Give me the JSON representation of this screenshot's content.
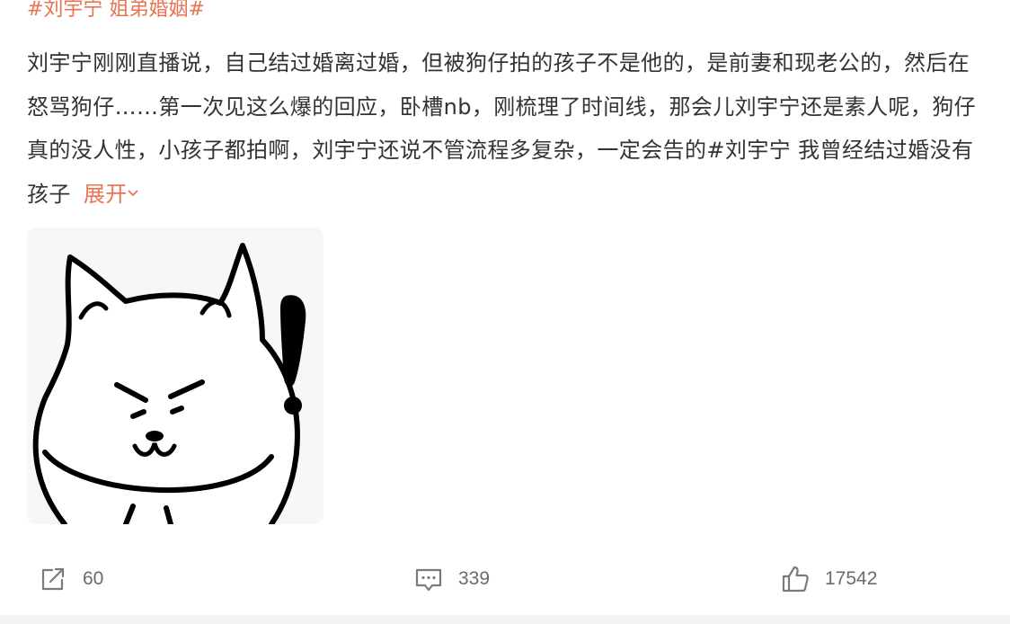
{
  "post": {
    "topics_top": [
      "#刘宇宁",
      "姐弟婚姻#"
    ],
    "body_text": "刘宇宁刚刚直播说，自己结过婚离过婚，但被狗仔拍的孩子不是他的，是前妻和现老公的，然后在怒骂狗仔……第一次见这么爆的回应，卧槽nb，刚梳理了时间线，那会儿刘宇宁还是素人呢，狗仔真的没人性，小孩子都拍啊，刘宇宁还说不管流程多复杂，一定会告的",
    "inline_topic": "#刘宇宁 我曾经结过婚没有孩子",
    "expand_label": "展开",
    "image": {
      "alt_icon": "cat-exclamation-sticker"
    }
  },
  "footer": {
    "repost": {
      "icon": "share-icon",
      "count": "60"
    },
    "comment": {
      "icon": "comment-icon",
      "count": "339"
    },
    "like": {
      "icon": "thumbs-up-icon",
      "count": "17542"
    }
  },
  "colors": {
    "accent": "#eb7350",
    "text": "#333333",
    "muted": "#808080",
    "divider": "#f2f2f2"
  }
}
